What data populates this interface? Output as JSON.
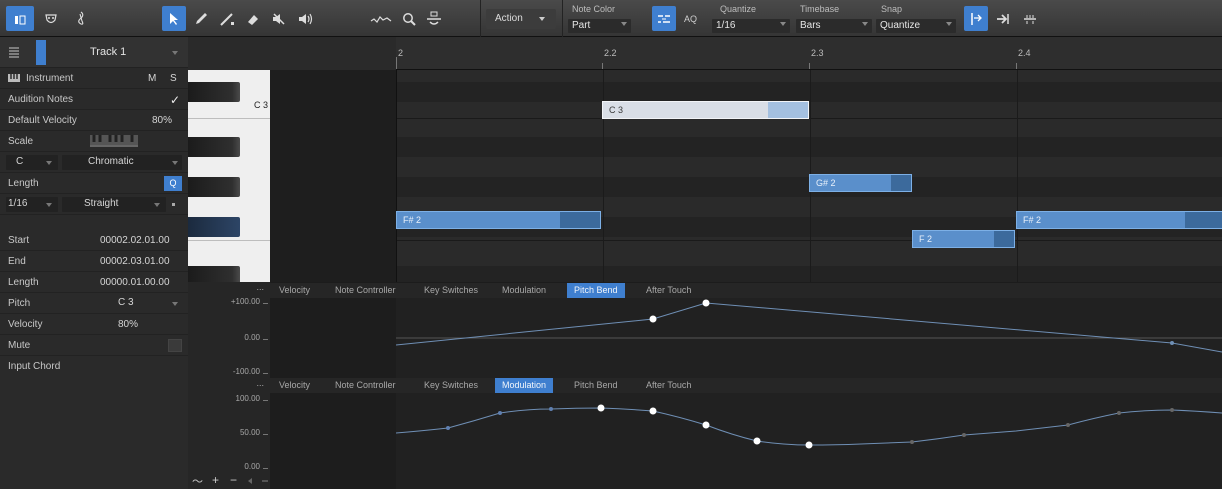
{
  "toolbar": {
    "action_label": "Action",
    "note_color": {
      "label": "Note Color",
      "value": "Part"
    },
    "aq_label": "AQ",
    "quantize": {
      "label": "Quantize",
      "value": "1/16"
    },
    "timebase": {
      "label": "Timebase",
      "value": "Bars"
    },
    "snap": {
      "label": "Snap",
      "value": "Quantize"
    }
  },
  "inspector": {
    "track_name": "Track 1",
    "instrument_label": "Instrument",
    "m_label": "M",
    "s_label": "S",
    "audition_notes_label": "Audition Notes",
    "audition_notes_checked": "✓",
    "default_velocity_label": "Default Velocity",
    "default_velocity_value": "80%",
    "scale_label": "Scale",
    "scale_root": "C",
    "scale_type": "Chromatic",
    "length_label": "Length",
    "length_q": "Q",
    "length_value": "1/16",
    "length_mode": "Straight",
    "start_label": "Start",
    "start_value": "00002.02.01.00",
    "end_label": "End",
    "end_value": "00002.03.01.00",
    "note_length_label": "Length",
    "note_length_value": "00000.01.00.00",
    "pitch_label": "Pitch",
    "pitch_value": "C 3",
    "velocity_label": "Velocity",
    "velocity_value": "80%",
    "mute_label": "Mute",
    "input_chord_label": "Input Chord"
  },
  "ruler": {
    "labels": [
      "2",
      "2.2",
      "2.3",
      "2.4"
    ]
  },
  "piano": {
    "c3_label": "C 3"
  },
  "notes": [
    {
      "label": "C 3",
      "selected": true
    },
    {
      "label": "G# 2",
      "selected": false
    },
    {
      "label": "F# 2",
      "selected": false
    },
    {
      "label": "F 2",
      "selected": false
    },
    {
      "label": "F# 2",
      "selected": false
    }
  ],
  "lane1": {
    "tabs": [
      "Velocity",
      "Note Controller",
      "Key Switches",
      "Modulation",
      "Pitch Bend",
      "After Touch"
    ],
    "active": "Pitch Bend",
    "scale": [
      "+100.00",
      "0.00",
      "-100.00"
    ]
  },
  "lane2": {
    "tabs": [
      "Velocity",
      "Note Controller",
      "Key Switches",
      "Modulation",
      "Pitch Bend",
      "After Touch"
    ],
    "active": "Modulation",
    "scale": [
      "100.00",
      "50.00",
      "0.00"
    ]
  },
  "lane_more_glyph": "...",
  "footer_glyphs": {
    "curve": "〜",
    "plus": "+",
    "minus": "−"
  },
  "icons": {
    "toolbar": [
      "show-inspector-icon",
      "editor-icon",
      "score-icon",
      "arrow-tool-icon",
      "pencil-tool-icon",
      "line-tool-icon",
      "eraser-tool-icon",
      "mute-tool-icon",
      "listen-tool-icon",
      "bend-tool-icon",
      "zoom-tool-icon",
      "split-tool-icon",
      "auto-scroll-icon",
      "follow-icon",
      "quantize-grid-icon"
    ]
  },
  "colors": {
    "accent": "#3f7fcf",
    "note": "#5a8fcb",
    "note_selected": "#d9dee6"
  }
}
